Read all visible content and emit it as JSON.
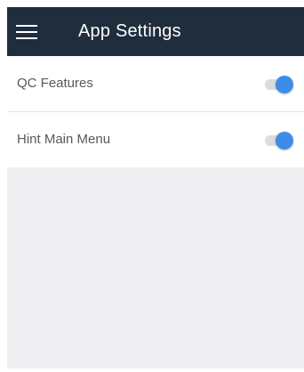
{
  "app_bar": {
    "title": "App Settings",
    "menu_icon": "hamburger-menu-icon",
    "background": "#1f2d3d"
  },
  "settings": [
    {
      "label": "QC Features",
      "enabled": true
    },
    {
      "label": "Hint Main Menu",
      "enabled": true
    }
  ],
  "colors": {
    "accent": "#3d8de8",
    "track_off": "#dcdcdc",
    "background": "#efeff2"
  }
}
